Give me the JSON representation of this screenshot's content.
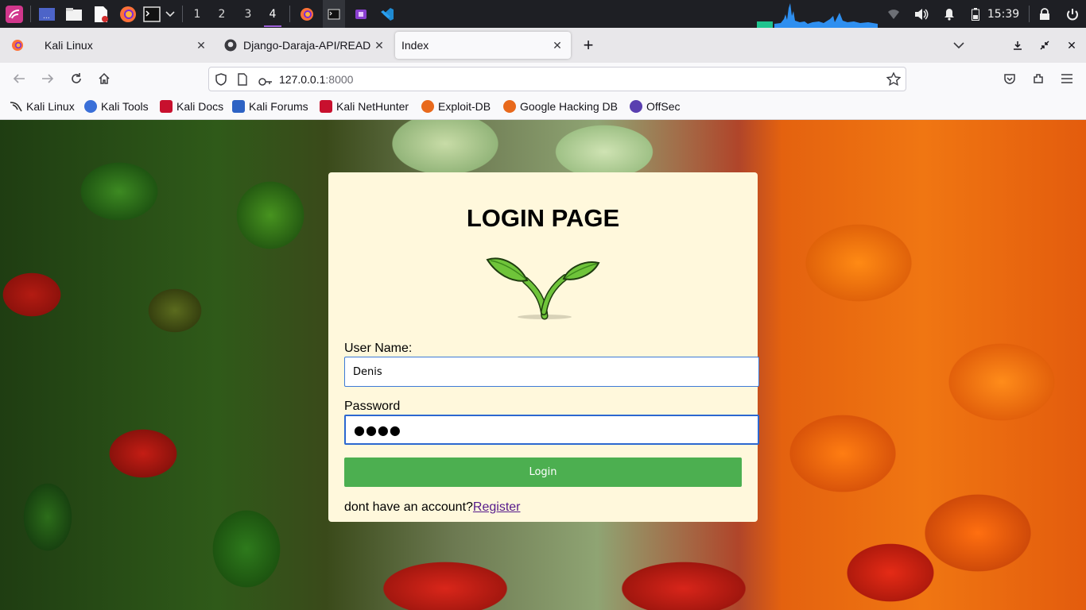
{
  "taskbar": {
    "workspaces": [
      "1",
      "2",
      "3",
      "4"
    ],
    "active_workspace": "4",
    "clock": "15:39",
    "icons": [
      "kali-menu-icon",
      "desktop-icon",
      "files-icon",
      "text-editor-icon",
      "firefox-icon",
      "terminal-icon",
      "chevron-down-icon",
      "firefox-task-icon",
      "terminal-task-icon",
      "app-task-icon",
      "vscode-icon",
      "network-icon",
      "volume-icon",
      "bell-icon",
      "battery-icon",
      "lock-icon",
      "power-icon"
    ]
  },
  "browser": {
    "tabs": [
      {
        "label": "Kali Linux",
        "active": false
      },
      {
        "label": "Django-Daraja-API/READ",
        "active": false
      },
      {
        "label": "Index",
        "active": true
      }
    ],
    "url_host": "127.0.0.1",
    "url_port": ":8000",
    "bookmarks": [
      {
        "label": "Kali Linux",
        "color": "#2b2b2b"
      },
      {
        "label": "Kali Tools",
        "color": "#3a6fd8"
      },
      {
        "label": "Kali Docs",
        "color": "#c8102e"
      },
      {
        "label": "Kali Forums",
        "color": "#2d62c4"
      },
      {
        "label": "Kali NetHunter",
        "color": "#c8102e"
      },
      {
        "label": "Exploit-DB",
        "color": "#e8691c"
      },
      {
        "label": "Google Hacking DB",
        "color": "#e8691c"
      },
      {
        "label": "OffSec",
        "color": "#5a3fb0"
      }
    ]
  },
  "login": {
    "title": "LOGIN PAGE",
    "username_label": "User Name:",
    "username_value": "Denis",
    "password_label": "Password",
    "password_mask": "●●●●",
    "button_label": "Login",
    "register_prompt": "dont have an account?",
    "register_link": "Register"
  },
  "colors": {
    "card_bg": "#fff8dc",
    "button_bg": "#4caf50",
    "link": "#551a8b"
  }
}
